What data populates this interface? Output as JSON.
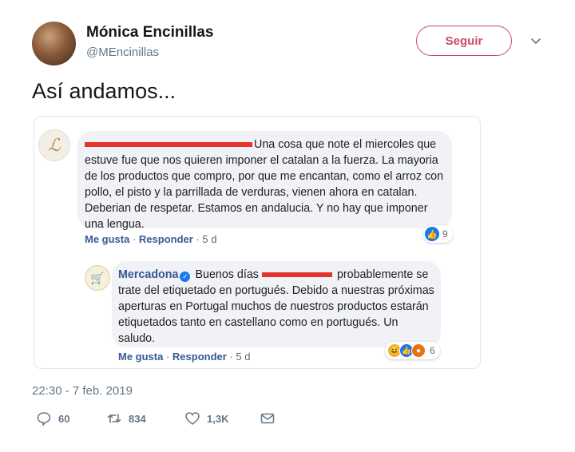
{
  "tweet": {
    "author_name": "Mónica Encinillas",
    "author_handle": "@MEncinillas",
    "follow_label": "Seguir",
    "text": "Así andamos...",
    "timestamp": "22:30 - 7 feb. 2019",
    "replies": "60",
    "retweets": "834",
    "likes": "1,3K"
  },
  "screenshot": {
    "comment1": {
      "text": "Una cosa que note el miercoles que estuve fue que nos quieren imponer el catalan a la fuerza. La mayoria de los productos que compro, por que me encantan, como el arroz con pollo, el pisto y la parrillada de verduras, vienen ahora en catalan. Deberian de respetar. Estamos en andalucia. Y no hay que imponer una lengua.",
      "like_label": "Me gusta",
      "reply_label": "Responder",
      "age": "5 d",
      "reaction_count": "9"
    },
    "reply": {
      "author": "Mercadona",
      "greeting": "Buenos días",
      "text": "probablemente se trate del etiquetado en portugués. Debido a nuestras próximas aperturas en Portugal muchos de nuestros productos estarán etiquetados tanto en castellano como en portugués. Un saludo.",
      "like_label": "Me gusta",
      "reply_label": "Responder",
      "age": "5 d",
      "reaction_count": "6"
    }
  },
  "colors": {
    "follow_accent": "#c94b6a",
    "link_blue": "#385898",
    "redaction": "#e3342f"
  },
  "icons": [
    "chevron-down-icon",
    "reply-icon",
    "retweet-icon",
    "heart-icon",
    "mail-icon",
    "like-reaction-icon",
    "haha-reaction-icon",
    "wow-reaction-icon",
    "verified-icon"
  ]
}
